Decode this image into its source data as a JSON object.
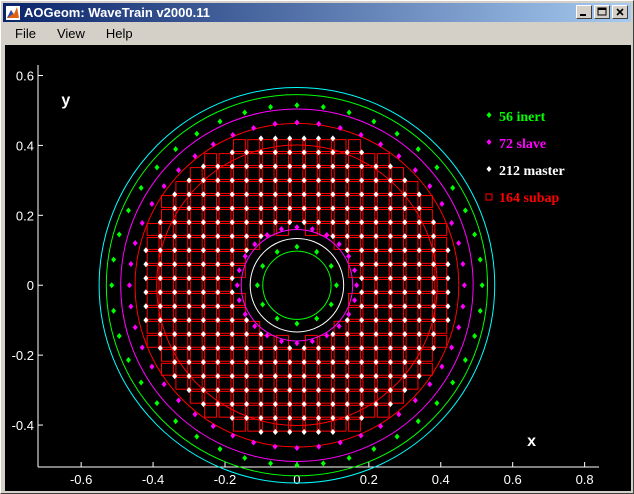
{
  "window": {
    "title": "AOGeom: WaveTrain v2000.11",
    "minimize_label": "_",
    "maximize_label": "□",
    "close_label": "×"
  },
  "menu": {
    "items": [
      {
        "label": "File"
      },
      {
        "label": "View"
      },
      {
        "label": "Help"
      }
    ]
  },
  "chart_data": {
    "type": "scatter",
    "title": "",
    "xlabel": "x",
    "ylabel": "y",
    "xlim": [
      -0.72,
      0.84
    ],
    "ylim": [
      -0.52,
      0.63
    ],
    "x_ticks": [
      -0.6,
      -0.4,
      -0.2,
      0,
      0.2,
      0.4,
      0.6,
      0.8
    ],
    "x_tick_labels": [
      "-0.6",
      "-0.4",
      "-0.2",
      "0",
      "0.2",
      "0.4",
      "0.6",
      "0.8"
    ],
    "y_ticks": [
      -0.4,
      -0.2,
      0,
      0.2,
      0.4,
      0.6
    ],
    "y_tick_labels": [
      "-0.4",
      "-0.2",
      "0",
      "0.2",
      "0.4",
      "0.6"
    ],
    "grid": false,
    "legend_placement": "top-right",
    "background": "#000000",
    "axis_color": "#ffffff",
    "series": [
      {
        "name": "56 inert",
        "marker": "diamond",
        "color": "#00ff00",
        "count": 56
      },
      {
        "name": "72 slave",
        "marker": "diamond",
        "color": "#ff00ff",
        "count": 72
      },
      {
        "name": "212 master",
        "marker": "diamond",
        "color": "#ffffff",
        "count": 212
      },
      {
        "name": "164 subap",
        "marker": "square",
        "color": "#ff0000",
        "count": 164
      }
    ],
    "circles": [
      {
        "radius": 0.55,
        "color": "#00ffff"
      },
      {
        "radius": 0.53,
        "color": "#00ff00"
      },
      {
        "radius": 0.49,
        "color": "#ff00ff"
      },
      {
        "radius": 0.45,
        "color": "#ff0000"
      },
      {
        "radius": 0.39,
        "color": "#ff0000"
      },
      {
        "radius": 0.155,
        "color": "#ff00ff"
      },
      {
        "radius": 0.13,
        "color": "#ffffff"
      },
      {
        "radius": 0.095,
        "color": "#00ff00"
      }
    ],
    "actuator_pitch": 0.04,
    "master_outer_radius": 0.435,
    "master_inner_radius": 0.17,
    "slave_outer_radius": 0.48,
    "slave_inner_radius": 0.2,
    "inert_outer_radius": 0.515,
    "inert_inner_radius": 0.1
  }
}
